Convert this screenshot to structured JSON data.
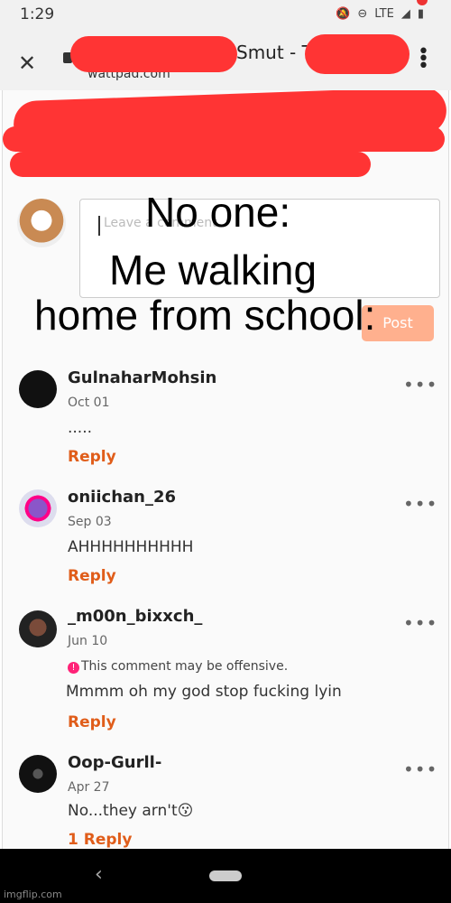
{
  "status": {
    "time": "1:29",
    "network": "LTE"
  },
  "browser": {
    "title": "Smut - T",
    "url": "wattpad.com"
  },
  "comment_form": {
    "placeholder": "Leave a comment",
    "post_label": "Post"
  },
  "meme": {
    "line1": "No one:",
    "line2": "Me walking",
    "line3": "home from school:"
  },
  "comments": [
    {
      "user": "GulnaharMohsin",
      "date": "Oct 01",
      "text": ".....",
      "reply": "Reply"
    },
    {
      "user": "oniichan_26",
      "date": "Sep 03",
      "text": "AHHHHHHHHHH",
      "reply": "Reply"
    },
    {
      "user": "_m00n_bixxch_",
      "date": "Jun 10",
      "warning": "This comment may be offensive.",
      "text": "Mmmm oh my god stop fucking lyin",
      "reply": "Reply"
    },
    {
      "user": "Oop-Gurll-",
      "date": "Apr 27",
      "text": "No...they arn't😗",
      "reply": "1 Reply"
    }
  ],
  "watermark": "imgflip.com",
  "colors": {
    "accent": "#e05d1a",
    "redaction": "#ff3434"
  }
}
